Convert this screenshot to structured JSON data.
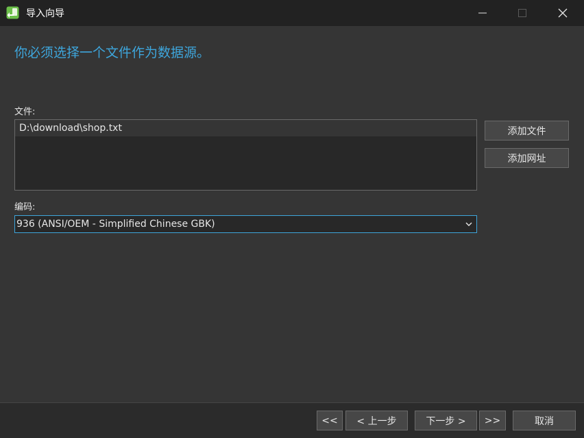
{
  "window": {
    "title": "导入向导",
    "icon": "import-wizard-app-icon",
    "controls": [
      "minimize-icon",
      "maximize-icon",
      "close-icon"
    ]
  },
  "heading": "你必须选择一个文件作为数据源。",
  "file_section": {
    "label": "文件:",
    "files": [
      "D:\\download\\shop.txt"
    ],
    "add_file_label": "添加文件",
    "add_url_label": "添加网址"
  },
  "encoding": {
    "label": "编码:",
    "selected": "936 (ANSI/OEM - Simplified Chinese GBK)"
  },
  "footer": {
    "first_label": "<<",
    "prev_label": "< 上一步",
    "next_label": "下一步 >",
    "last_label": ">>",
    "cancel_label": "取消"
  },
  "colors": {
    "accent": "#3ea6dc",
    "background": "#353535",
    "titlebar": "#222222",
    "button": "#474747"
  }
}
